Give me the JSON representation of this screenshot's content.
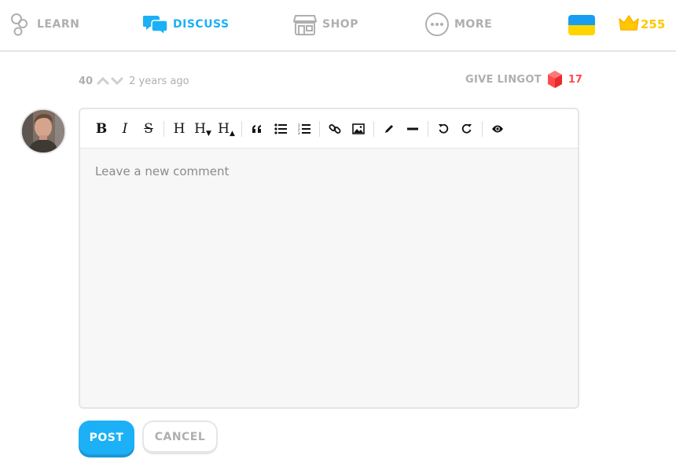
{
  "nav": {
    "learn": {
      "label": "LEARN",
      "icon": "learn-icon"
    },
    "discuss": {
      "label": "DISCUSS",
      "icon": "discuss-icon",
      "active": true
    },
    "shop": {
      "label": "SHOP",
      "icon": "shop-icon"
    },
    "more": {
      "label": "MORE",
      "icon": "more-icon"
    },
    "language_flag": {
      "icon": "ukraine-flag-icon",
      "colors": [
        "#1a9cf0",
        "#ffd500"
      ]
    },
    "crowns": {
      "icon": "crown-icon",
      "count": "255",
      "color": "#ffc800"
    }
  },
  "post_meta": {
    "votes": "40",
    "time_ago": "2 years ago",
    "give_lingot_label": "GIVE LINGOT",
    "lingot_count": "17",
    "lingot_color": "#ff4b4b"
  },
  "editor": {
    "toolbar": {
      "bold": "B",
      "italic": "I",
      "strikethrough": "S",
      "heading": "H",
      "heading_smaller": "H",
      "heading_bigger": "H",
      "icons": [
        "quote-icon",
        "bullet-list-icon",
        "numbered-list-icon",
        "link-icon",
        "image-icon",
        "pencil-icon",
        "horizontal-rule-icon",
        "undo-icon",
        "redo-icon",
        "preview-eye-icon"
      ]
    },
    "placeholder": "Leave a new comment"
  },
  "actions": {
    "post_label": "POST",
    "cancel_label": "CANCEL",
    "accent": "#1cb0f6"
  }
}
